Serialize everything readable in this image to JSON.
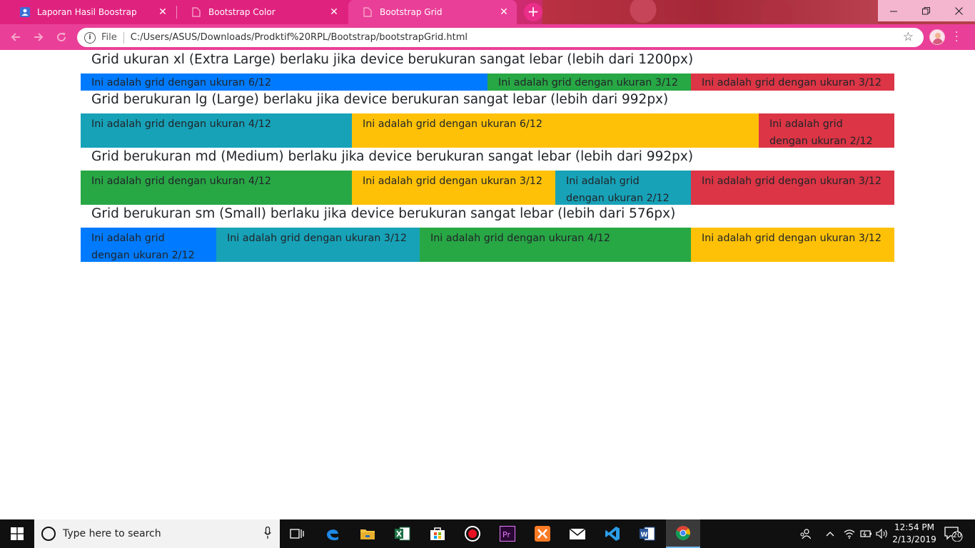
{
  "browser": {
    "tabs": [
      {
        "title": "Laporan Hasil Boostrap",
        "active": false
      },
      {
        "title": "Bootstrap Color",
        "active": false
      },
      {
        "title": "Bootstrap Grid",
        "active": true
      }
    ],
    "address": {
      "scheme_label": "File",
      "url": "C:/Users/ASUS/Downloads/Prodktif%20RPL/Bootstrap/bootstrapGrid.html"
    },
    "accent_color": "#e0227f"
  },
  "page": {
    "sections": [
      {
        "heading": "Grid ukuran xl (Extra Large) berlaku jika device berukuran sangat lebar (lebih dari 1200px)",
        "columns": [
          {
            "text": "Ini adalah grid dengan ukuran 6/12",
            "span": 6,
            "color": "#007bff"
          },
          {
            "text": "Ini adalah grid dengan ukuran 3/12",
            "span": 3,
            "color": "#28a745"
          },
          {
            "text": "Ini adalah grid dengan ukuran 3/12",
            "span": 3,
            "color": "#dc3545"
          }
        ]
      },
      {
        "heading": "Grid berukuran lg (Large) berlaku jika device berukuran sangat lebar (lebih dari 992px)",
        "columns": [
          {
            "text": "Ini adalah grid dengan ukuran 4/12",
            "span": 4,
            "color": "#17a2b8"
          },
          {
            "text": "Ini adalah grid dengan ukuran 6/12",
            "span": 6,
            "color": "#ffc107"
          },
          {
            "text": "Ini adalah grid dengan ukuran 2/12",
            "span": 2,
            "color": "#dc3545"
          }
        ]
      },
      {
        "heading": "Grid berukuran md (Medium) berlaku jika device berukuran sangat lebar (lebih dari 992px)",
        "columns": [
          {
            "text": "Ini adalah grid dengan ukuran 4/12",
            "span": 4,
            "color": "#28a745"
          },
          {
            "text": "Ini adalah grid dengan ukuran 3/12",
            "span": 3,
            "color": "#ffc107"
          },
          {
            "text": "Ini adalah grid dengan ukuran 2/12",
            "span": 2,
            "color": "#17a2b8"
          },
          {
            "text": "Ini adalah grid dengan ukuran 3/12",
            "span": 3,
            "color": "#dc3545"
          }
        ]
      },
      {
        "heading": "Grid berukuran sm (Small) berlaku jika device berukuran sangat lebar (lebih dari 576px)",
        "columns": [
          {
            "text": "Ini adalah grid dengan ukuran 2/12",
            "span": 2,
            "color": "#007bff"
          },
          {
            "text": "Ini adalah grid dengan ukuran 3/12",
            "span": 3,
            "color": "#17a2b8"
          },
          {
            "text": "Ini adalah grid dengan ukuran 4/12",
            "span": 4,
            "color": "#28a745"
          },
          {
            "text": "Ini adalah grid dengan ukuran 3/12",
            "span": 3,
            "color": "#ffc107"
          }
        ]
      }
    ]
  },
  "taskbar": {
    "search_placeholder": "Type here to search",
    "time": "12:54 PM",
    "date": "2/13/2019",
    "notification_count": "20",
    "apps": [
      "task-view",
      "edge",
      "file-explorer",
      "excel",
      "store",
      "recorder",
      "premiere",
      "xampp",
      "mail",
      "vscode",
      "word",
      "chrome"
    ]
  }
}
